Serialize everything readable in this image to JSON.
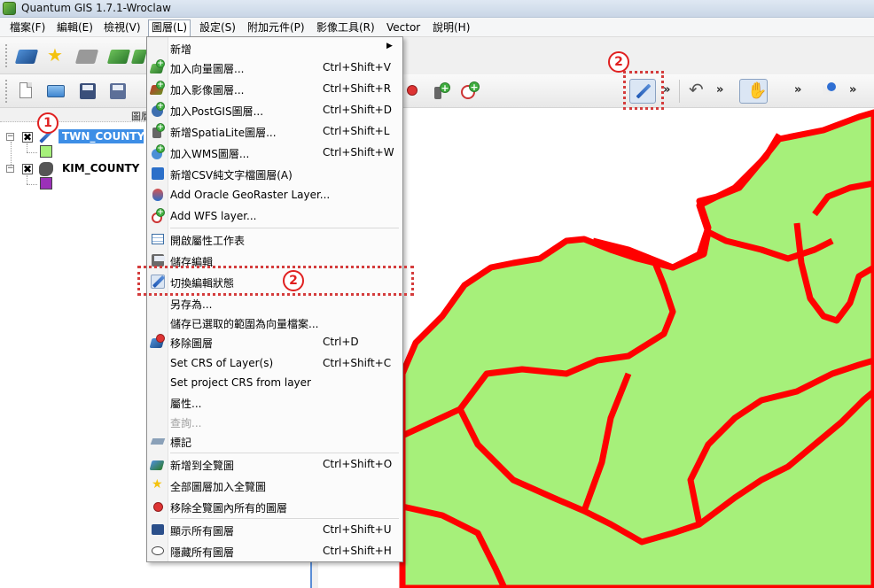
{
  "window": {
    "title": "Quantum GIS 1.7.1-Wroclaw"
  },
  "menubar": {
    "items": [
      {
        "label": "檔案(F)"
      },
      {
        "label": "編輯(E)"
      },
      {
        "label": "檢視(V)"
      },
      {
        "label": "圖層(L)"
      },
      {
        "label": "設定(S)"
      },
      {
        "label": "附加元件(P)"
      },
      {
        "label": "影像工具(R)"
      },
      {
        "label": "Vector"
      },
      {
        "label": "說明(H)"
      }
    ]
  },
  "toolbar": {
    "chevron": "»"
  },
  "layers_panel": {
    "title": "圖層",
    "layers": [
      {
        "name": "TWN_COUNTY",
        "checked": "✖",
        "expander": "−",
        "swatch_color": "#a6f07a"
      },
      {
        "name": "KIM_COUNTY",
        "checked": "✖",
        "expander": "−",
        "swatch_color": "#9b30b8"
      }
    ]
  },
  "layer_menu": {
    "items": [
      {
        "label": "新增",
        "shortcut": "",
        "icon": "none",
        "submenu": "▶"
      },
      {
        "label": "加入向量圖層...",
        "shortcut": "Ctrl+Shift+V",
        "icon": "add-vector-icon"
      },
      {
        "label": "加入影像圖層...",
        "shortcut": "Ctrl+Shift+R",
        "icon": "add-raster-icon"
      },
      {
        "label": "加入PostGIS圖層...",
        "shortcut": "Ctrl+Shift+D",
        "icon": "add-postgis-icon"
      },
      {
        "label": "新增SpatiaLite圖層...",
        "shortcut": "Ctrl+Shift+L",
        "icon": "add-spatialite-icon"
      },
      {
        "label": "加入WMS圖層...",
        "shortcut": "Ctrl+Shift+W",
        "icon": "add-wms-icon"
      },
      {
        "label": "新增CSV純文字檔圖層(A)",
        "shortcut": "",
        "icon": "add-csv-icon"
      },
      {
        "label": "Add Oracle GeoRaster Layer...",
        "shortcut": "",
        "icon": "oracle-icon"
      },
      {
        "label": "Add WFS layer...",
        "shortcut": "",
        "icon": "add-wfs-icon"
      },
      {
        "label": "開啟屬性工作表",
        "shortcut": "",
        "icon": "attribute-table-icon"
      },
      {
        "label": "儲存編輯",
        "shortcut": "",
        "icon": "save-edits-icon"
      },
      {
        "label": "切換編輯狀態",
        "shortcut": "",
        "icon": "toggle-editing-icon"
      },
      {
        "label": "另存為...",
        "shortcut": "",
        "icon": "none"
      },
      {
        "label": "儲存已選取的範圍為向量檔案...",
        "shortcut": "",
        "icon": "none"
      },
      {
        "label": "移除圖層",
        "shortcut": "Ctrl+D",
        "icon": "remove-layer-icon"
      },
      {
        "label": "Set CRS of Layer(s)",
        "shortcut": "Ctrl+Shift+C",
        "icon": "none"
      },
      {
        "label": "Set project CRS from layer",
        "shortcut": "",
        "icon": "none"
      },
      {
        "label": "屬性...",
        "shortcut": "",
        "icon": "none"
      },
      {
        "label": "查詢...",
        "shortcut": "",
        "icon": "none",
        "disabled": true
      },
      {
        "label": "標記",
        "shortcut": "",
        "icon": "label-icon"
      },
      {
        "label": "新增到全覽圖",
        "shortcut": "Ctrl+Shift+O",
        "icon": "add-overview-icon"
      },
      {
        "label": "全部圖層加入全覽圖",
        "shortcut": "",
        "icon": "add-all-overview-icon"
      },
      {
        "label": "移除全覽圖內所有的圖層",
        "shortcut": "",
        "icon": "remove-all-overview-icon"
      },
      {
        "label": "顯示所有圖層",
        "shortcut": "Ctrl+Shift+U",
        "icon": "show-all-icon"
      },
      {
        "label": "隱藏所有圖層",
        "shortcut": "Ctrl+Shift+H",
        "icon": "hide-all-icon"
      }
    ]
  },
  "annotations": {
    "marker_1": "1",
    "marker_2a": "2",
    "marker_2b": "2"
  },
  "map": {
    "fill_color": "#a6f07a",
    "boundary_color": "#ff0000"
  }
}
